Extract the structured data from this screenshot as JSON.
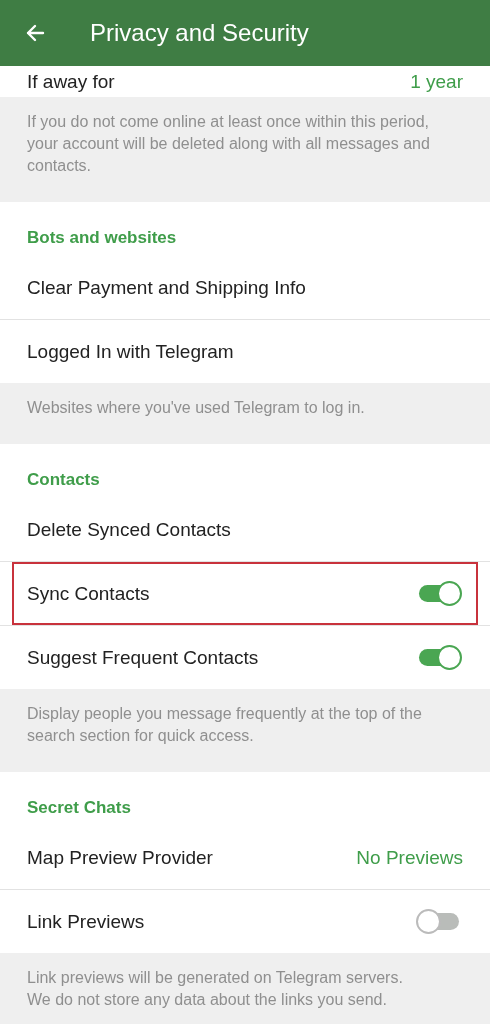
{
  "app_bar": {
    "title": "Privacy and Security"
  },
  "sections": [
    {
      "items": [
        {
          "kind": "value",
          "label": "If away for",
          "value": "1 year"
        }
      ],
      "footer": "If you do not come online at least once within this period, your account will be deleted along with all messages and contacts."
    },
    {
      "header": "Bots and websites",
      "items": [
        {
          "kind": "row",
          "label": "Clear Payment and Shipping Info"
        },
        {
          "kind": "row",
          "label": "Logged In with Telegram"
        }
      ],
      "footer": "Websites where you've used Telegram to log in."
    },
    {
      "header": "Contacts",
      "items": [
        {
          "kind": "row",
          "label": "Delete Synced Contacts"
        },
        {
          "kind": "toggle",
          "label": "Sync Contacts",
          "on": true,
          "highlighted": true
        },
        {
          "kind": "toggle",
          "label": "Suggest Frequent Contacts",
          "on": true,
          "highlighted": false
        }
      ],
      "footer": "Display people you message frequently at the top of the search section for quick access."
    },
    {
      "header": "Secret Chats",
      "items": [
        {
          "kind": "value",
          "label": "Map Preview Provider",
          "value": "No Previews"
        },
        {
          "kind": "toggle",
          "label": "Link Previews",
          "on": false,
          "highlighted": false
        }
      ],
      "footer": "Link previews will be generated on Telegram servers. We do not store any data about the links you send."
    }
  ]
}
